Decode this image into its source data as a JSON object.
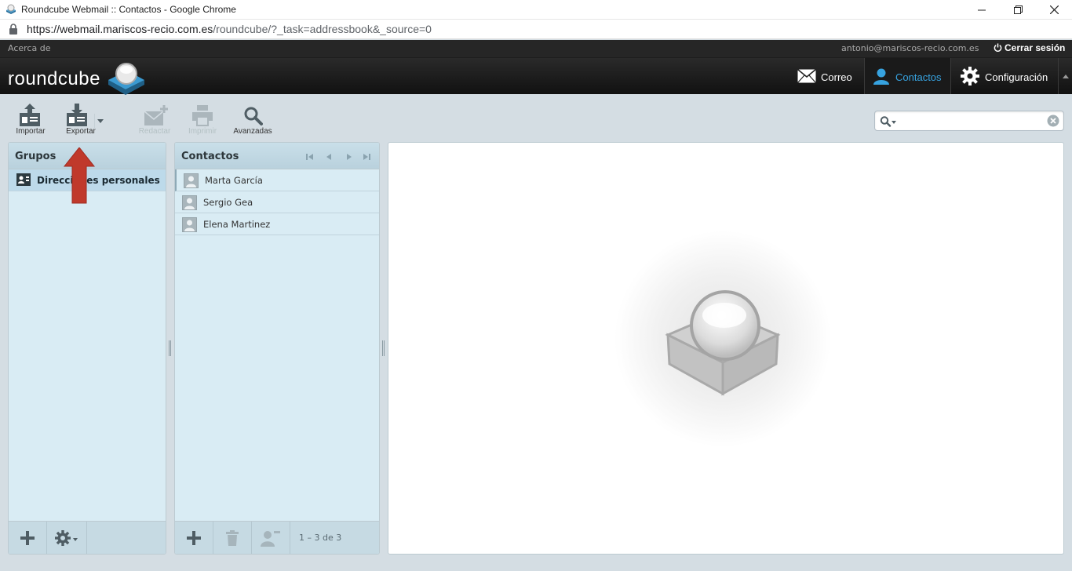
{
  "browser": {
    "window_title": "Roundcube Webmail :: Contactos - Google Chrome",
    "url_host": "https://webmail.mariscos-recio.com.es",
    "url_path": "/roundcube/?_task=addressbook&_source=0"
  },
  "topline": {
    "about": "Acerca de",
    "user": "antonio@mariscos-recio.com.es",
    "logout": "Cerrar sesión"
  },
  "header": {
    "logo": "roundcube",
    "nav": {
      "mail": "Correo",
      "contacts": "Contactos",
      "settings": "Configuración"
    },
    "active_color": "#37a3e0"
  },
  "toolbar": {
    "import": "Importar",
    "export": "Exportar",
    "compose": "Redactar",
    "print": "Imprimir",
    "advanced": "Avanzadas"
  },
  "search": {
    "value": ""
  },
  "groups": {
    "title": "Grupos",
    "items": [
      {
        "label": "Direcciones personales",
        "selected": true
      }
    ]
  },
  "contacts": {
    "title": "Contactos",
    "items": [
      {
        "name": "Marta García"
      },
      {
        "name": "Sergio Gea"
      },
      {
        "name": "Elena Martinez"
      }
    ],
    "count": "1 – 3 de 3"
  },
  "annotation": {
    "type": "arrow-up",
    "color": "#c0392b",
    "target": "Exportar"
  }
}
